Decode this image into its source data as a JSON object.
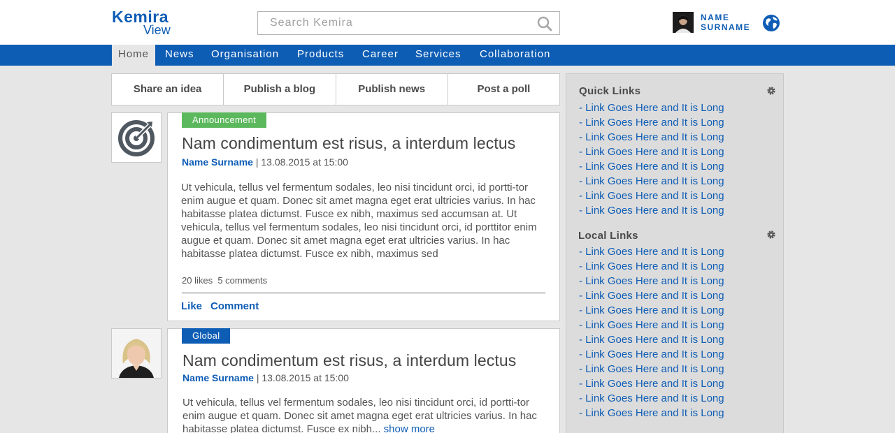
{
  "brand": {
    "name": "Kemira",
    "sub": "View"
  },
  "search": {
    "placeholder": "Search Kemira"
  },
  "user": {
    "first": "NAME",
    "last": "SURNAME"
  },
  "nav": [
    "Home",
    "News",
    "Organisation",
    "Products",
    "Career",
    "Services",
    "Collaboration"
  ],
  "actions": [
    "Share an idea",
    "Publish a blog",
    "Publish news",
    "Post a poll"
  ],
  "posts": [
    {
      "badge": "Announcement",
      "badge_color": "#5cb85c",
      "title": "Nam condimentum est risus, a interdum lectus",
      "author": "Name Surname",
      "date": " | 13.08.2015 at 15:00",
      "body": "Ut vehicula, tellus vel fermentum sodales, leo nisi tincidunt orci, id portti-tor enim augue et quam. Donec sit amet magna eget erat ultricies varius. In hac habitasse platea dictumst. Fusce ex nibh, maximus sed accumsan at. Ut vehicula, tellus vel fermentum sodales, leo nisi tincidunt orci, id porttitor enim augue et quam. Donec sit amet magna eget erat ultricies varius. In hac habitasse platea dictumst. Fusce ex nibh, maximus sed",
      "likes": "20 likes",
      "comments": "5 comments",
      "like_label": "Like",
      "comment_label": "Comment"
    },
    {
      "badge": "Global",
      "badge_color": "#0e5db5",
      "title": "Nam condimentum est risus, a interdum lectus",
      "author": "Name Surname",
      "date": " | 13.08.2015 at 15:00",
      "body": "Ut vehicula, tellus vel fermentum sodales, leo nisi tincidunt orci, id portti-tor enim augue et quam. Donec sit amet magna eget erat ultricies varius. In hac habitasse platea dictumst. Fusce ex nibh...",
      "show_more": "show more"
    }
  ],
  "sidebar": {
    "quick_title": "Quick Links",
    "quick_links": [
      "- Link Goes Here and It is Long",
      "- Link Goes Here and It is Long",
      "- Link Goes Here and It is Long",
      "- Link Goes Here and It is Long",
      "- Link Goes Here and It is Long",
      "- Link Goes Here and It is Long",
      "- Link Goes Here and It is Long",
      "- Link Goes Here and It is Long"
    ],
    "local_title": "Local Links",
    "local_links": [
      "- Link Goes Here and It is Long",
      "- Link Goes Here and It is Long",
      "- Link Goes Here and It is Long",
      "- Link Goes Here and It is Long",
      "- Link Goes Here and It is Long",
      "- Link Goes Here and It is Long",
      "- Link Goes Here and It is Long",
      "- Link Goes Here and It is Long",
      "- Link Goes Here and It is Long",
      "- Link Goes Here and It is Long",
      "- Link Goes Here and It is Long",
      "- Link Goes Here and It is Long"
    ]
  },
  "colors": {
    "brand": "#0e5db5",
    "announcement": "#5cb85c",
    "global": "#0e5db5"
  }
}
